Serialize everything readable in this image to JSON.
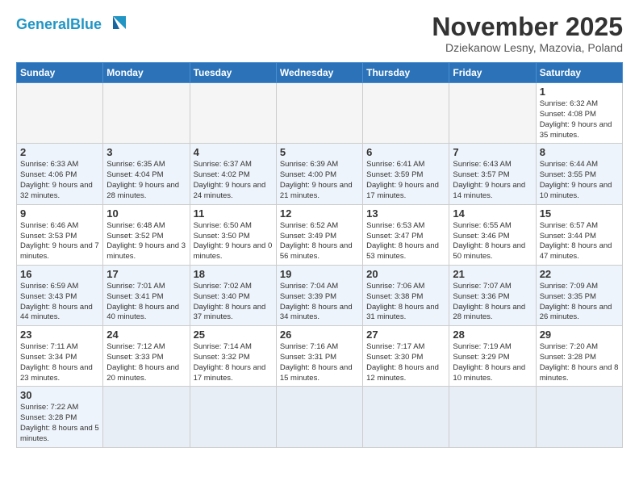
{
  "header": {
    "logo_general": "General",
    "logo_blue": "Blue",
    "month_year": "November 2025",
    "location": "Dziekanow Lesny, Mazovia, Poland"
  },
  "weekdays": [
    "Sunday",
    "Monday",
    "Tuesday",
    "Wednesday",
    "Thursday",
    "Friday",
    "Saturday"
  ],
  "weeks": [
    [
      {
        "day": "",
        "info": ""
      },
      {
        "day": "",
        "info": ""
      },
      {
        "day": "",
        "info": ""
      },
      {
        "day": "",
        "info": ""
      },
      {
        "day": "",
        "info": ""
      },
      {
        "day": "",
        "info": ""
      },
      {
        "day": "1",
        "info": "Sunrise: 6:32 AM\nSunset: 4:08 PM\nDaylight: 9 hours\nand 35 minutes."
      }
    ],
    [
      {
        "day": "2",
        "info": "Sunrise: 6:33 AM\nSunset: 4:06 PM\nDaylight: 9 hours\nand 32 minutes."
      },
      {
        "day": "3",
        "info": "Sunrise: 6:35 AM\nSunset: 4:04 PM\nDaylight: 9 hours\nand 28 minutes."
      },
      {
        "day": "4",
        "info": "Sunrise: 6:37 AM\nSunset: 4:02 PM\nDaylight: 9 hours\nand 24 minutes."
      },
      {
        "day": "5",
        "info": "Sunrise: 6:39 AM\nSunset: 4:00 PM\nDaylight: 9 hours\nand 21 minutes."
      },
      {
        "day": "6",
        "info": "Sunrise: 6:41 AM\nSunset: 3:59 PM\nDaylight: 9 hours\nand 17 minutes."
      },
      {
        "day": "7",
        "info": "Sunrise: 6:43 AM\nSunset: 3:57 PM\nDaylight: 9 hours\nand 14 minutes."
      },
      {
        "day": "8",
        "info": "Sunrise: 6:44 AM\nSunset: 3:55 PM\nDaylight: 9 hours\nand 10 minutes."
      }
    ],
    [
      {
        "day": "9",
        "info": "Sunrise: 6:46 AM\nSunset: 3:53 PM\nDaylight: 9 hours\nand 7 minutes."
      },
      {
        "day": "10",
        "info": "Sunrise: 6:48 AM\nSunset: 3:52 PM\nDaylight: 9 hours\nand 3 minutes."
      },
      {
        "day": "11",
        "info": "Sunrise: 6:50 AM\nSunset: 3:50 PM\nDaylight: 9 hours\nand 0 minutes."
      },
      {
        "day": "12",
        "info": "Sunrise: 6:52 AM\nSunset: 3:49 PM\nDaylight: 8 hours\nand 56 minutes."
      },
      {
        "day": "13",
        "info": "Sunrise: 6:53 AM\nSunset: 3:47 PM\nDaylight: 8 hours\nand 53 minutes."
      },
      {
        "day": "14",
        "info": "Sunrise: 6:55 AM\nSunset: 3:46 PM\nDaylight: 8 hours\nand 50 minutes."
      },
      {
        "day": "15",
        "info": "Sunrise: 6:57 AM\nSunset: 3:44 PM\nDaylight: 8 hours\nand 47 minutes."
      }
    ],
    [
      {
        "day": "16",
        "info": "Sunrise: 6:59 AM\nSunset: 3:43 PM\nDaylight: 8 hours\nand 44 minutes."
      },
      {
        "day": "17",
        "info": "Sunrise: 7:01 AM\nSunset: 3:41 PM\nDaylight: 8 hours\nand 40 minutes."
      },
      {
        "day": "18",
        "info": "Sunrise: 7:02 AM\nSunset: 3:40 PM\nDaylight: 8 hours\nand 37 minutes."
      },
      {
        "day": "19",
        "info": "Sunrise: 7:04 AM\nSunset: 3:39 PM\nDaylight: 8 hours\nand 34 minutes."
      },
      {
        "day": "20",
        "info": "Sunrise: 7:06 AM\nSunset: 3:38 PM\nDaylight: 8 hours\nand 31 minutes."
      },
      {
        "day": "21",
        "info": "Sunrise: 7:07 AM\nSunset: 3:36 PM\nDaylight: 8 hours\nand 28 minutes."
      },
      {
        "day": "22",
        "info": "Sunrise: 7:09 AM\nSunset: 3:35 PM\nDaylight: 8 hours\nand 26 minutes."
      }
    ],
    [
      {
        "day": "23",
        "info": "Sunrise: 7:11 AM\nSunset: 3:34 PM\nDaylight: 8 hours\nand 23 minutes."
      },
      {
        "day": "24",
        "info": "Sunrise: 7:12 AM\nSunset: 3:33 PM\nDaylight: 8 hours\nand 20 minutes."
      },
      {
        "day": "25",
        "info": "Sunrise: 7:14 AM\nSunset: 3:32 PM\nDaylight: 8 hours\nand 17 minutes."
      },
      {
        "day": "26",
        "info": "Sunrise: 7:16 AM\nSunset: 3:31 PM\nDaylight: 8 hours\nand 15 minutes."
      },
      {
        "day": "27",
        "info": "Sunrise: 7:17 AM\nSunset: 3:30 PM\nDaylight: 8 hours\nand 12 minutes."
      },
      {
        "day": "28",
        "info": "Sunrise: 7:19 AM\nSunset: 3:29 PM\nDaylight: 8 hours\nand 10 minutes."
      },
      {
        "day": "29",
        "info": "Sunrise: 7:20 AM\nSunset: 3:28 PM\nDaylight: 8 hours\nand 8 minutes."
      }
    ],
    [
      {
        "day": "30",
        "info": "Sunrise: 7:22 AM\nSunset: 3:28 PM\nDaylight: 8 hours\nand 5 minutes."
      },
      {
        "day": "",
        "info": ""
      },
      {
        "day": "",
        "info": ""
      },
      {
        "day": "",
        "info": ""
      },
      {
        "day": "",
        "info": ""
      },
      {
        "day": "",
        "info": ""
      },
      {
        "day": "",
        "info": ""
      }
    ]
  ]
}
